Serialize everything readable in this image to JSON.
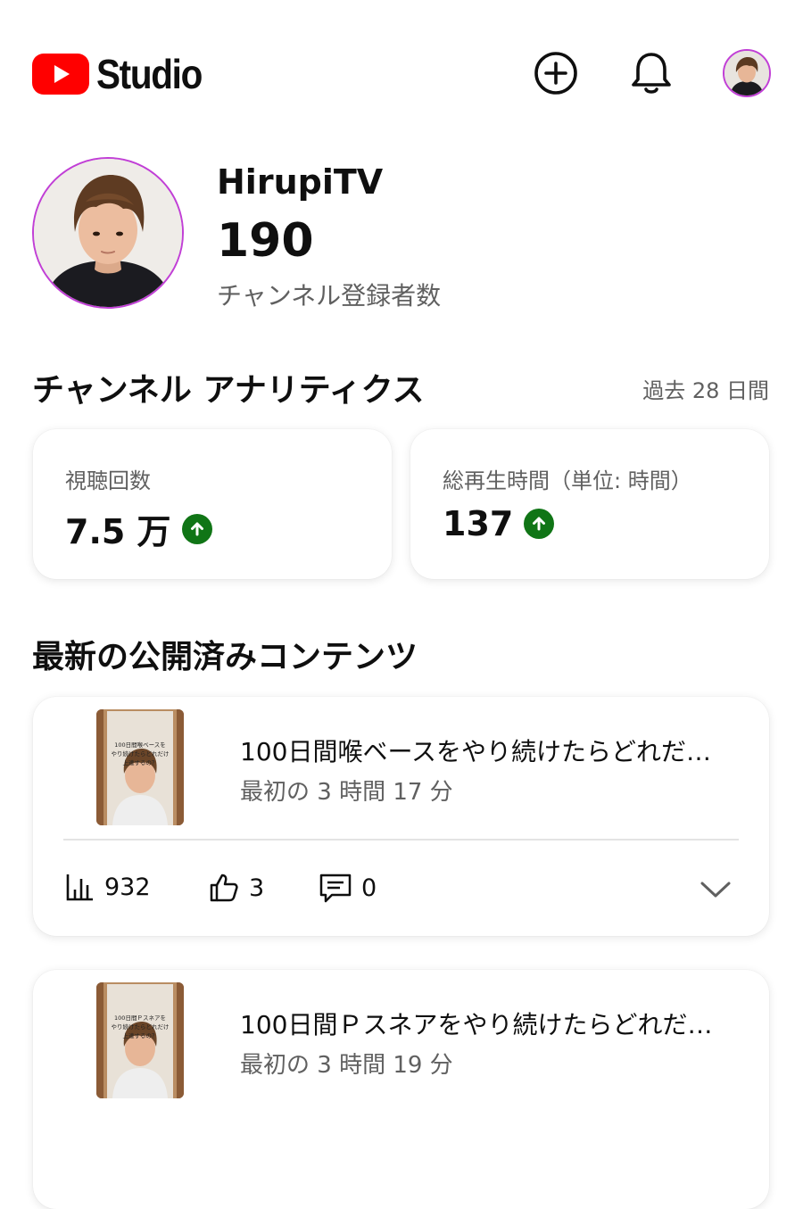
{
  "header": {
    "brand": "Studio",
    "icons": [
      "create-icon",
      "bell-icon",
      "account-avatar"
    ]
  },
  "channel": {
    "name": "HirupiTV",
    "subscriber_count": "190",
    "subscriber_label": "チャンネル登録者数"
  },
  "analytics": {
    "title": "チャンネル アナリティクス",
    "period": "過去 28 日間",
    "stats": [
      {
        "label": "視聴回数",
        "value": "7.5 万",
        "trend": "up"
      },
      {
        "label": "総再生時間（単位: 時間）",
        "value": "137",
        "trend": "up"
      }
    ]
  },
  "latest": {
    "title": "最新の公開済みコンテンツ",
    "items": [
      {
        "title": "100日間喉ベースをやり続けたらどれだ…",
        "meta": "最初の 3 時間 17 分",
        "views": "932",
        "likes": "3",
        "comments": "0",
        "thumb_text": "100日間喉ベースをやり続けたらどれだけ上達するの？"
      },
      {
        "title": "100日間Ｐスネアをやり続けたらどれだ…",
        "meta": "最初の 3 時間 19 分",
        "thumb_text": "100日間Ｐスネアをやり続けたらどれだけ上達するの？"
      }
    ]
  },
  "colors": {
    "brand_red": "#ff0000",
    "trend_up": "#107516",
    "avatar_ring": "#c13fd6",
    "secondary_text": "#606060"
  }
}
